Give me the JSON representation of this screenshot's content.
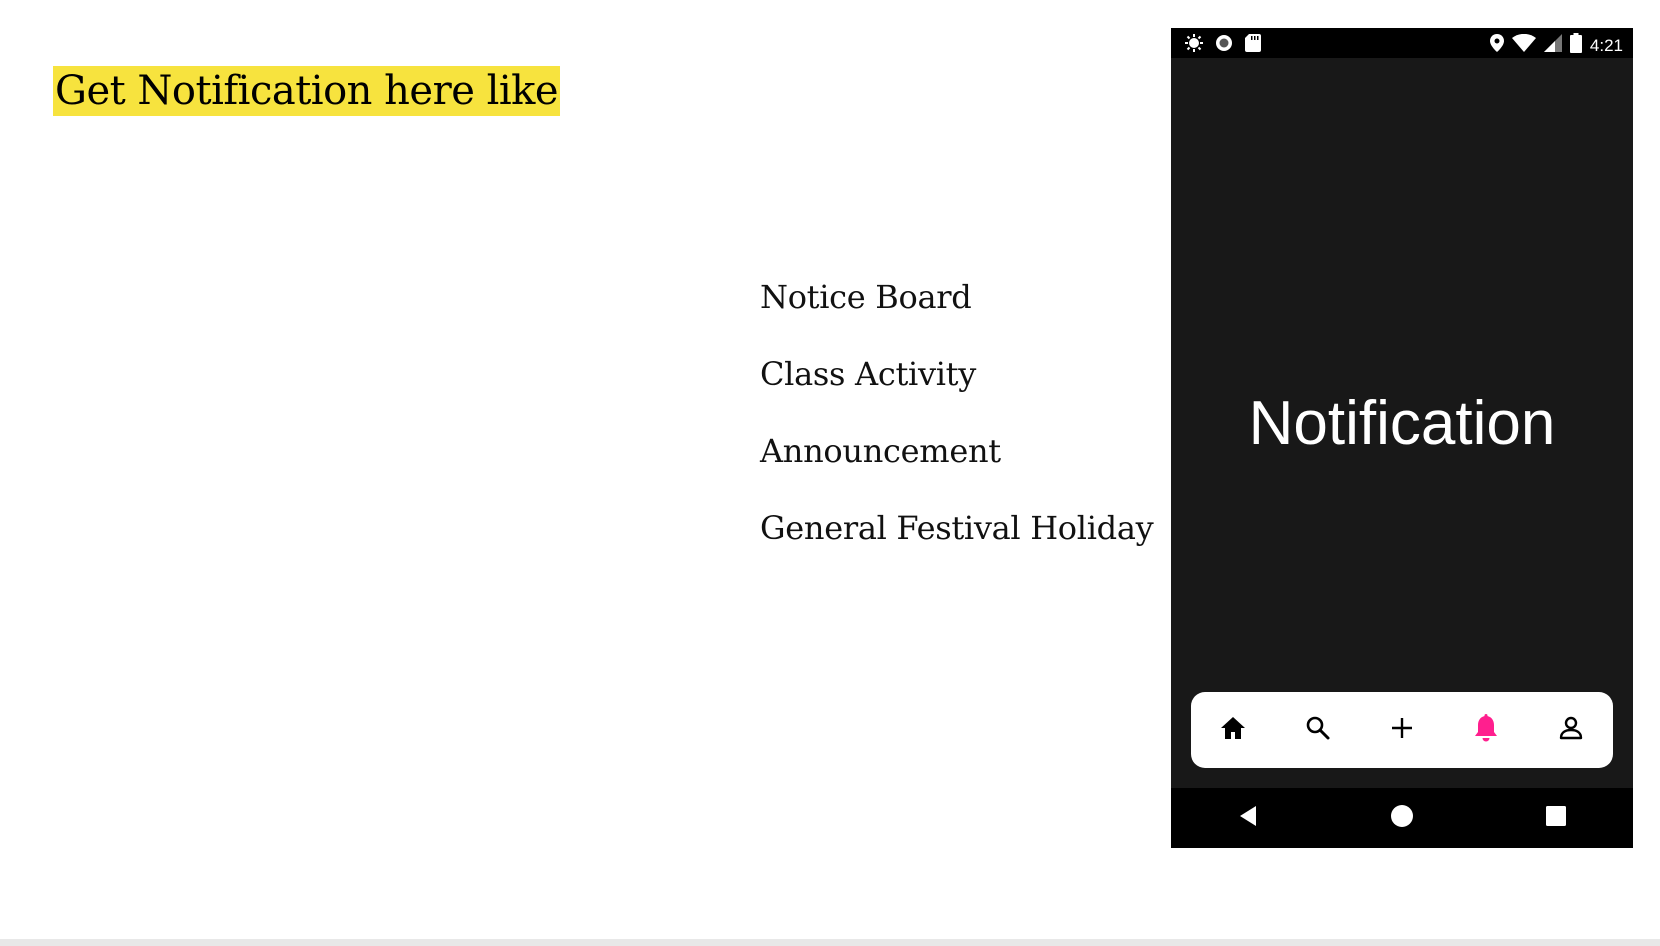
{
  "slide": {
    "heading": "Get Notification here like",
    "categories": [
      "Notice Board",
      "Class Activity",
      "Announcement",
      "General Festival Holiday"
    ]
  },
  "phone": {
    "status_bar": {
      "time": "4:21",
      "left_icons": [
        "settings-gear-icon",
        "record-circle-icon",
        "sd-card-icon"
      ],
      "right_icons": [
        "location-pin-icon",
        "wifi-icon",
        "cell-signal-icon",
        "battery-icon"
      ]
    },
    "screen_title": "Notification",
    "bottom_nav": {
      "items": [
        "home-icon",
        "search-icon",
        "add-icon",
        "bell-icon",
        "profile-icon"
      ],
      "active": "bell-icon",
      "active_color": "#ff1f8e"
    },
    "system_nav": [
      "back-icon",
      "home-circle-icon",
      "recents-square-icon"
    ]
  },
  "colors": {
    "highlight": "#f7e33e",
    "phone_background": "#181818"
  }
}
